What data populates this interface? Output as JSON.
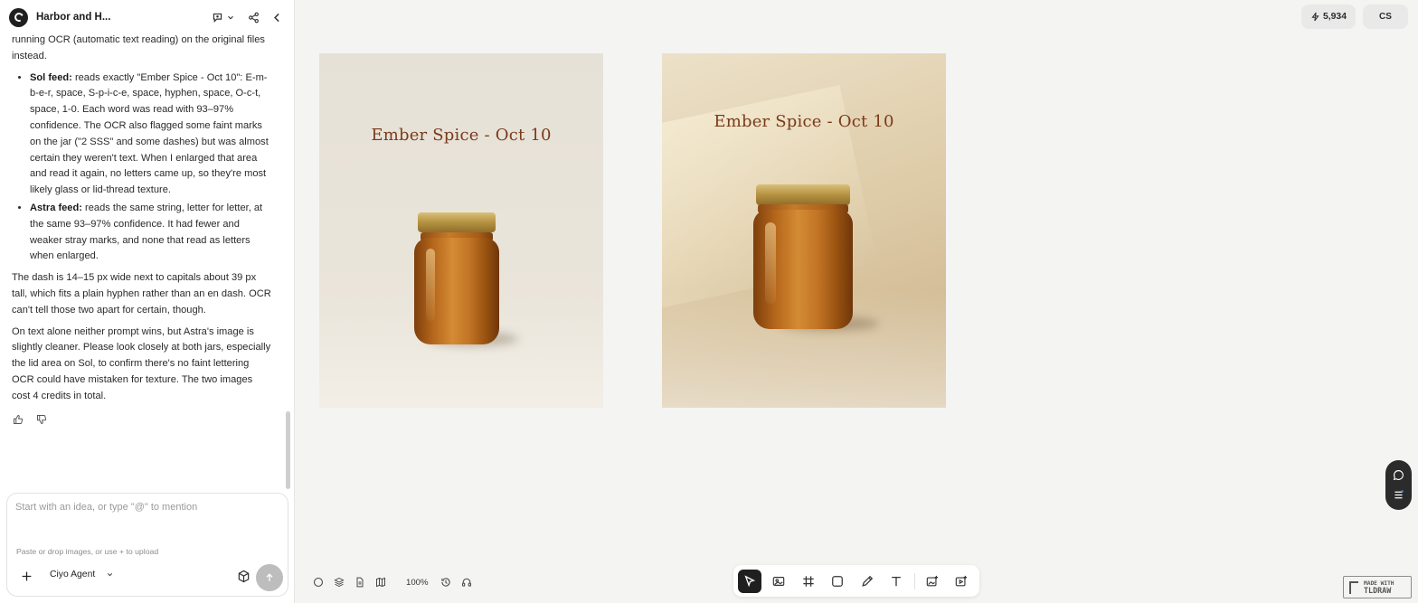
{
  "header": {
    "title": "Harbor and H..."
  },
  "chat": {
    "intro_tail": "running OCR (automatic text reading) on the original files instead.",
    "bullets": [
      {
        "label": "Sol feed:",
        "text": " reads exactly \"Ember Spice - Oct 10\": E-m-b-e-r, space, S-p-i-c-e, space, hyphen, space, O-c-t, space, 1-0. Each word was read with 93–97% confidence. The OCR also flagged some faint marks on the jar (\"2 SSS\" and some dashes) but was almost certain they weren't text. When I enlarged that area and read it again, no letters came up, so they're most likely glass or lid-thread texture."
      },
      {
        "label": "Astra feed:",
        "text": " reads the same string, letter for letter, at the same 93–97% confidence. It had fewer and weaker stray marks, and none that read as letters when enlarged."
      }
    ],
    "para_dash": "The dash is 14–15 px wide next to capitals about 39 px tall, which fits a plain hyphen rather than an en dash. OCR can't tell those two apart for certain, though.",
    "para_summary": "On text alone neither prompt wins, but Astra's image is slightly cleaner. Please look closely at both jars, especially the lid area on Sol, to confirm there's no faint lettering OCR could have mistaken for texture. The two images cost 4 credits in total."
  },
  "composer": {
    "placeholder": "Start with an idea, or type \"@\" to mention",
    "upload_hint": "Paste or drop images, or use + to upload",
    "agent": "Ciyo Agent"
  },
  "topbar": {
    "credits": "5,934",
    "avatar_initials": "CS"
  },
  "canvas": {
    "images": [
      {
        "label": "Ember Spice - Oct 10"
      },
      {
        "label": "Ember Spice - Oct 10"
      }
    ],
    "zoom": "100%"
  },
  "badge": {
    "line1": "MADE WITH",
    "line2": "TLDRAW"
  },
  "colors": {
    "accent": "#1f1f1f",
    "label_text": "#7a3a1a",
    "honey": "#c27425",
    "lid_gold": "#b59241"
  },
  "icons": {
    "header": [
      "chat-bubble-icon",
      "chevron-down-icon",
      "share-icon",
      "collapse-left-icon"
    ],
    "toolbar": [
      "select-arrow-icon",
      "image-generate-icon",
      "frame-hash-icon",
      "rectangle-icon",
      "pencil-icon",
      "text-icon",
      "add-image-icon",
      "add-video-icon"
    ],
    "bottom_left": [
      "circle-icon",
      "layers-icon",
      "document-icon",
      "map-icon",
      "history-icon",
      "headset-icon"
    ]
  }
}
